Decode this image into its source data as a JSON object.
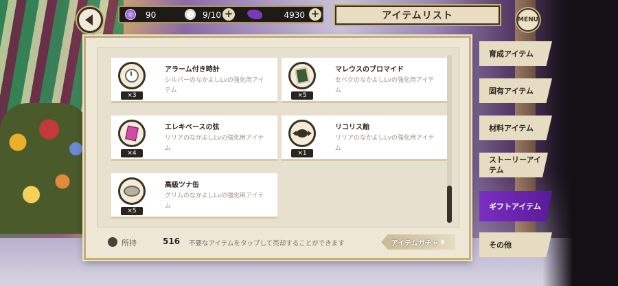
{
  "header": {
    "title": "アイテムリスト",
    "menu_label": "MENU",
    "resources": {
      "gems": "90",
      "stamina": "9/10",
      "coins": "4930"
    },
    "plus_label": "+"
  },
  "items": [
    {
      "name": "アラーム付き時計",
      "desc": "シルバーのなかよしLvの強化用アイテム",
      "qty": "×3",
      "icon": "clock-icon"
    },
    {
      "name": "マレウスのブロマイド",
      "desc": "セベクのなかよしLvの強化用アイテム",
      "qty": "×5",
      "icon": "photo-icon"
    },
    {
      "name": "エレキベースの弦",
      "desc": "リリアのなかよしLvの強化用アイテム",
      "qty": "×4",
      "icon": "guitar-icon"
    },
    {
      "name": "リコリス飴",
      "desc": "リリアのなかよしLvの強化用アイテム",
      "qty": "×1",
      "icon": "candy-icon"
    },
    {
      "name": "高級ツナ缶",
      "desc": "グリムのなかよしLvの強化用アイテム",
      "qty": "×5",
      "icon": "can-icon"
    }
  ],
  "footer": {
    "owned_label": "所持",
    "owned_value": "516",
    "hint": "不要なアイテムをタップして売却することができます",
    "gacha_label": "アイテムガチャ"
  },
  "tabs": [
    {
      "label": "育成アイテム",
      "active": false
    },
    {
      "label": "固有アイテム",
      "active": false
    },
    {
      "label": "材料アイテム",
      "active": false
    },
    {
      "label": "ストーリーアイテム",
      "active": false
    },
    {
      "label": "ギフトアイテム",
      "active": true
    },
    {
      "label": "その他",
      "active": false
    }
  ],
  "colors": {
    "active_tab": "#6a22b0",
    "panel": "#efe7d6",
    "accent_gold": "#c3ad7d"
  }
}
